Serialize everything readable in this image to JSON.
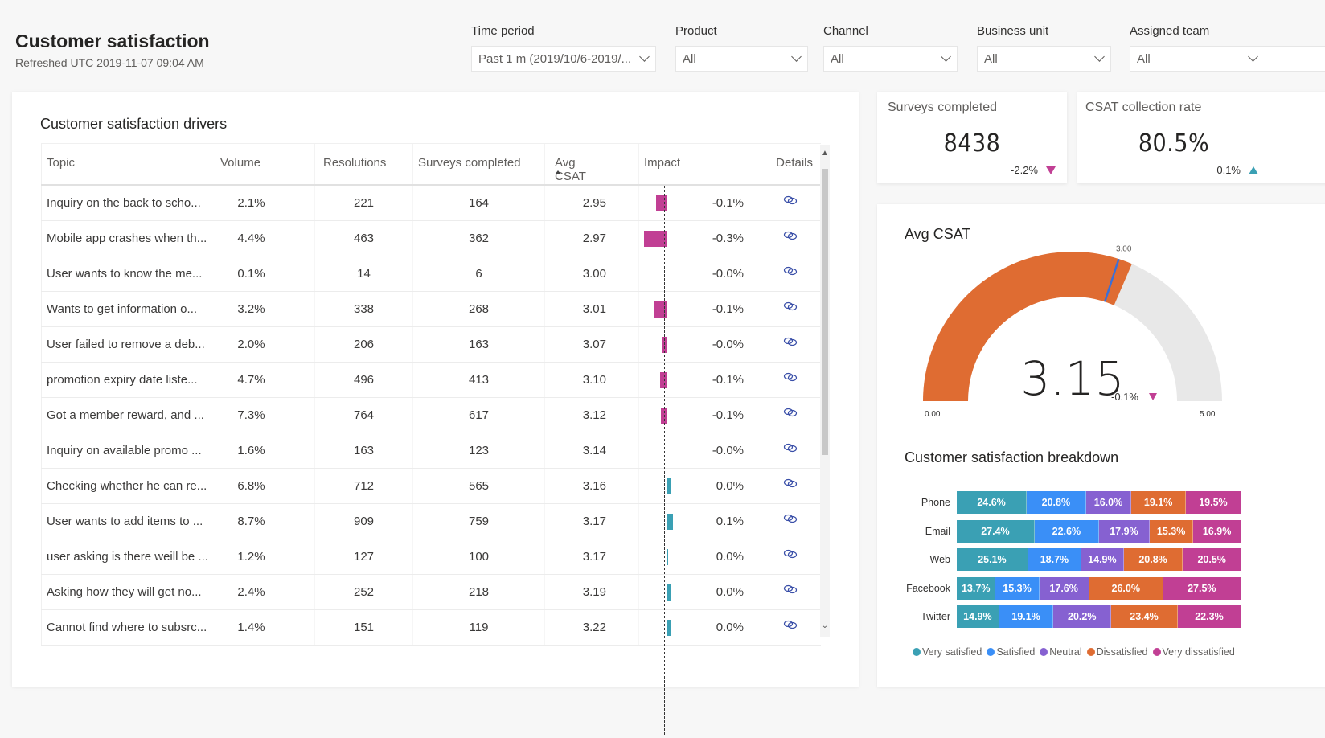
{
  "header": {
    "title": "Customer satisfaction",
    "refreshed": "Refreshed UTC 2019-11-07 09:04 AM"
  },
  "filters": [
    {
      "label": "Time period",
      "value": "Past 1 m (2019/10/6-2019/..."
    },
    {
      "label": "Product",
      "value": "All"
    },
    {
      "label": "Channel",
      "value": "All"
    },
    {
      "label": "Business unit",
      "value": "All"
    },
    {
      "label": "Assigned team",
      "value": "All"
    }
  ],
  "drivers": {
    "title": "Customer satisfaction drivers",
    "columns": [
      "Topic",
      "Volume",
      "Resolutions",
      "Surveys completed",
      "Avg CSAT",
      "Impact",
      "Details"
    ],
    "sorted_column": "Avg CSAT",
    "sort_direction": "ascending",
    "rows": [
      {
        "topic": "Inquiry on the back to scho...",
        "volume": "2.1%",
        "resolutions": "221",
        "surveys": "164",
        "avg_csat": "2.95",
        "impact": "-0.1%",
        "impact_value": -0.14
      },
      {
        "topic": "Mobile app crashes when th...",
        "volume": "4.4%",
        "resolutions": "463",
        "surveys": "362",
        "avg_csat": "2.97",
        "impact": "-0.3%",
        "impact_value": -0.3
      },
      {
        "topic": "User wants to know the me...",
        "volume": "0.1%",
        "resolutions": "14",
        "surveys": "6",
        "avg_csat": "3.00",
        "impact": "-0.0%",
        "impact_value": 0
      },
      {
        "topic": "Wants to get information o...",
        "volume": "3.2%",
        "resolutions": "338",
        "surveys": "268",
        "avg_csat": "3.01",
        "impact": "-0.1%",
        "impact_value": -0.16
      },
      {
        "topic": "User failed to remove a deb...",
        "volume": "2.0%",
        "resolutions": "206",
        "surveys": "163",
        "avg_csat": "3.07",
        "impact": "-0.0%",
        "impact_value": -0.05
      },
      {
        "topic": "promotion expiry date liste...",
        "volume": "4.7%",
        "resolutions": "496",
        "surveys": "413",
        "avg_csat": "3.10",
        "impact": "-0.1%",
        "impact_value": -0.09
      },
      {
        "topic": "Got a member reward, and ...",
        "volume": "7.3%",
        "resolutions": "764",
        "surveys": "617",
        "avg_csat": "3.12",
        "impact": "-0.1%",
        "impact_value": -0.08
      },
      {
        "topic": "Inquiry on available promo ...",
        "volume": "1.6%",
        "resolutions": "163",
        "surveys": "123",
        "avg_csat": "3.14",
        "impact": "-0.0%",
        "impact_value": 0
      },
      {
        "topic": "Checking whether he can re...",
        "volume": "6.8%",
        "resolutions": "712",
        "surveys": "565",
        "avg_csat": "3.16",
        "impact": "0.0%",
        "impact_value": 0.05
      },
      {
        "topic": "User wants to add items to ...",
        "volume": "8.7%",
        "resolutions": "909",
        "surveys": "759",
        "avg_csat": "3.17",
        "impact": "0.1%",
        "impact_value": 0.09
      },
      {
        "topic": "user asking is there weill be ...",
        "volume": "1.2%",
        "resolutions": "127",
        "surveys": "100",
        "avg_csat": "3.17",
        "impact": "0.0%",
        "impact_value": 0.01
      },
      {
        "topic": "Asking how they will get no...",
        "volume": "2.4%",
        "resolutions": "252",
        "surveys": "218",
        "avg_csat": "3.19",
        "impact": "0.0%",
        "impact_value": 0.05
      },
      {
        "topic": "Cannot find where to subsrc...",
        "volume": "1.4%",
        "resolutions": "151",
        "surveys": "119",
        "avg_csat": "3.22",
        "impact": "0.0%",
        "impact_value": 0.05
      }
    ],
    "details_icon": "link-icon"
  },
  "kpis": [
    {
      "title": "Surveys completed",
      "value": "8438",
      "delta": "-2.2%",
      "trend": "down"
    },
    {
      "title": "CSAT collection rate",
      "value": "80.5%",
      "delta": "0.1%",
      "trend": "up"
    }
  ],
  "gauge": {
    "title": "Avg CSAT",
    "value": 3.15,
    "value_label": "3.15",
    "delta": "-0.1%",
    "trend": "down",
    "min": 0,
    "max": 5,
    "min_label": "0.00",
    "max_label": "5.00",
    "target": 3.0,
    "target_label": "3.00"
  },
  "colors": {
    "very_satisfied": "#3aa0b4",
    "satisfied": "#3a8ff7",
    "neutral": "#8661d1",
    "dissatisfied": "#df6c32",
    "very_dissatisfied": "#c13f94",
    "gauge_fill": "#df6c32",
    "gauge_track": "#e8e8e8",
    "gauge_target": "#3b6fd6",
    "link": "#3a4fa8"
  },
  "chart_data": {
    "type": "bar",
    "orientation": "horizontal",
    "stacked": "100%",
    "title": "Customer satisfaction breakdown",
    "categories": [
      "Phone",
      "Email",
      "Web",
      "Facebook",
      "Twitter"
    ],
    "series": [
      {
        "name": "Very satisfied",
        "values": [
          24.6,
          27.4,
          25.1,
          13.7,
          14.9
        ]
      },
      {
        "name": "Satisfied",
        "values": [
          20.8,
          22.6,
          18.7,
          15.3,
          19.1
        ]
      },
      {
        "name": "Neutral",
        "values": [
          16.0,
          17.9,
          14.9,
          17.6,
          20.2
        ]
      },
      {
        "name": "Dissatisfied",
        "values": [
          19.1,
          15.3,
          20.8,
          26.0,
          23.4
        ]
      },
      {
        "name": "Very dissatisfied",
        "values": [
          19.5,
          16.9,
          20.5,
          27.5,
          22.3
        ]
      }
    ],
    "legend_position": "bottom",
    "data_labels": true,
    "unit": "%"
  }
}
